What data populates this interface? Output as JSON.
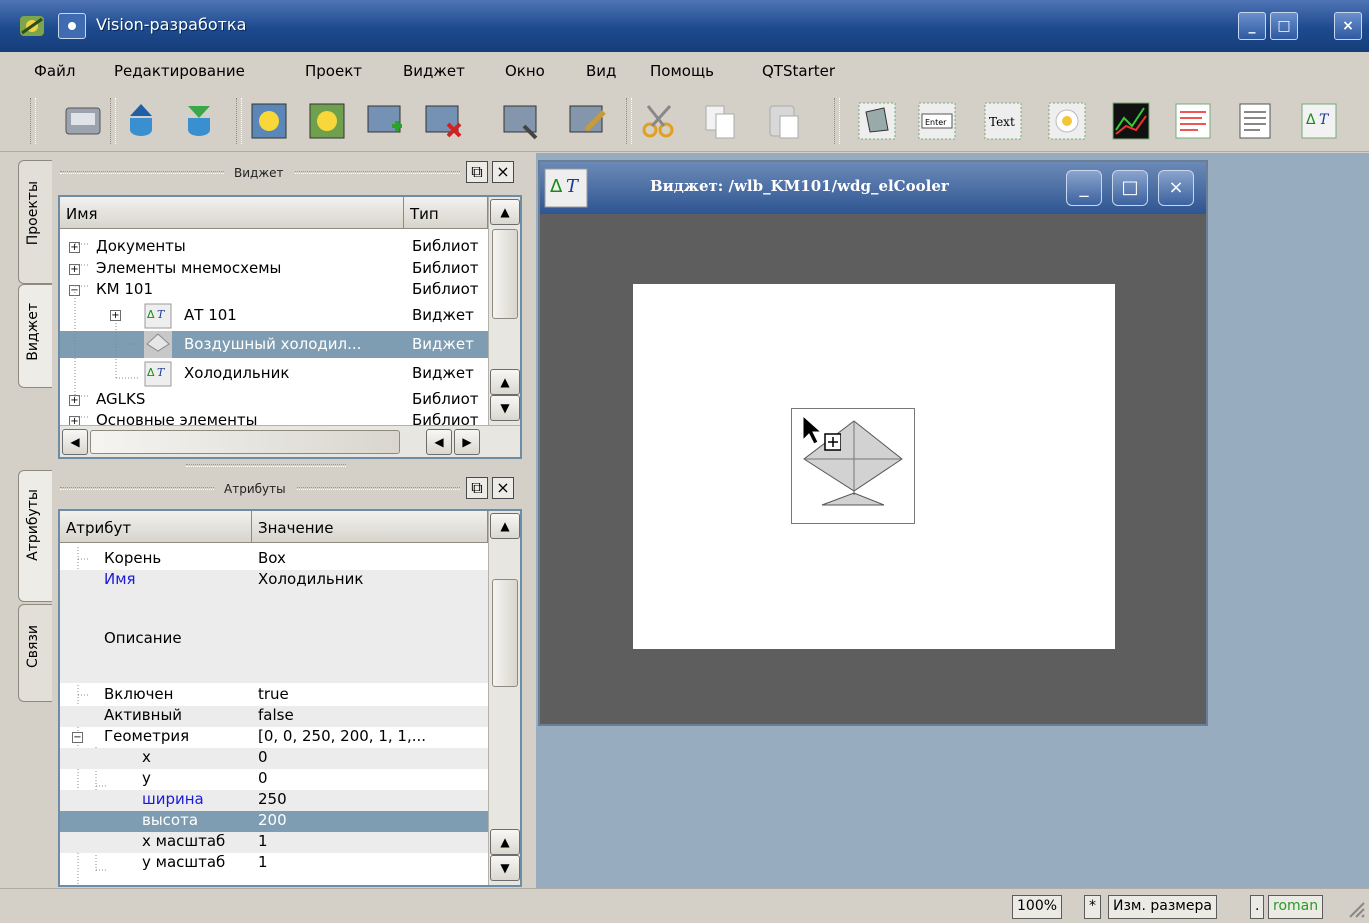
{
  "window": {
    "title": "Vision-разработка"
  },
  "menu": [
    "Файл",
    "Редактирование",
    "Проект",
    "Виджет",
    "Окно",
    "Вид",
    "Помощь",
    "QTStarter"
  ],
  "left_tabs": {
    "top": [
      "Проекты",
      "Виджет"
    ],
    "bottom": [
      "Атрибуты",
      "Связи"
    ]
  },
  "widget_dock": {
    "title": "Виджет",
    "col_name": "Имя",
    "col_type": "Тип",
    "rows": [
      {
        "name": "Документы",
        "type": "Библиот"
      },
      {
        "name": "Элементы мнемосхемы",
        "type": "Библиот"
      },
      {
        "name": "КМ 101",
        "type": "Библиот"
      },
      {
        "name": "АТ 101",
        "type": "Виджет"
      },
      {
        "name": "Воздушный холодил...",
        "type": "Виджет"
      },
      {
        "name": "Холодильник",
        "type": "Виджет"
      },
      {
        "name": "AGLKS",
        "type": "Библиот"
      },
      {
        "name": "Основные элементы",
        "type": "Библиот"
      }
    ]
  },
  "attr_dock": {
    "title": "Атрибуты",
    "col_attr": "Атрибут",
    "col_value": "Значение",
    "rows": [
      {
        "name": "Корень",
        "value": "Box"
      },
      {
        "name": "Имя",
        "value": "Холодильник"
      },
      {
        "name": "Описание",
        "value": ""
      },
      {
        "name": "Включен",
        "value": "true"
      },
      {
        "name": "Активный",
        "value": "false"
      },
      {
        "name": "Геометрия",
        "value": "[0, 0, 250, 200, 1, 1,..."
      },
      {
        "name": "x",
        "value": "0"
      },
      {
        "name": "y",
        "value": "0"
      },
      {
        "name": "ширина",
        "value": "250"
      },
      {
        "name": "высота",
        "value": "200"
      },
      {
        "name": "x масштаб",
        "value": "1"
      },
      {
        "name": "y масштаб",
        "value": "1"
      }
    ]
  },
  "subwindow": {
    "title": "Виджет: /wlb_KM101/wdg_elCooler"
  },
  "status": {
    "zoom": "100%",
    "star": "*",
    "mode": "Изм. размера",
    "dot": ".",
    "user": "roman"
  },
  "colors": {
    "selection": "#7f9db2",
    "mdi_background": "#97acbf",
    "user_text": "#2a9a2a",
    "highlight_text": "#1a1adc"
  }
}
